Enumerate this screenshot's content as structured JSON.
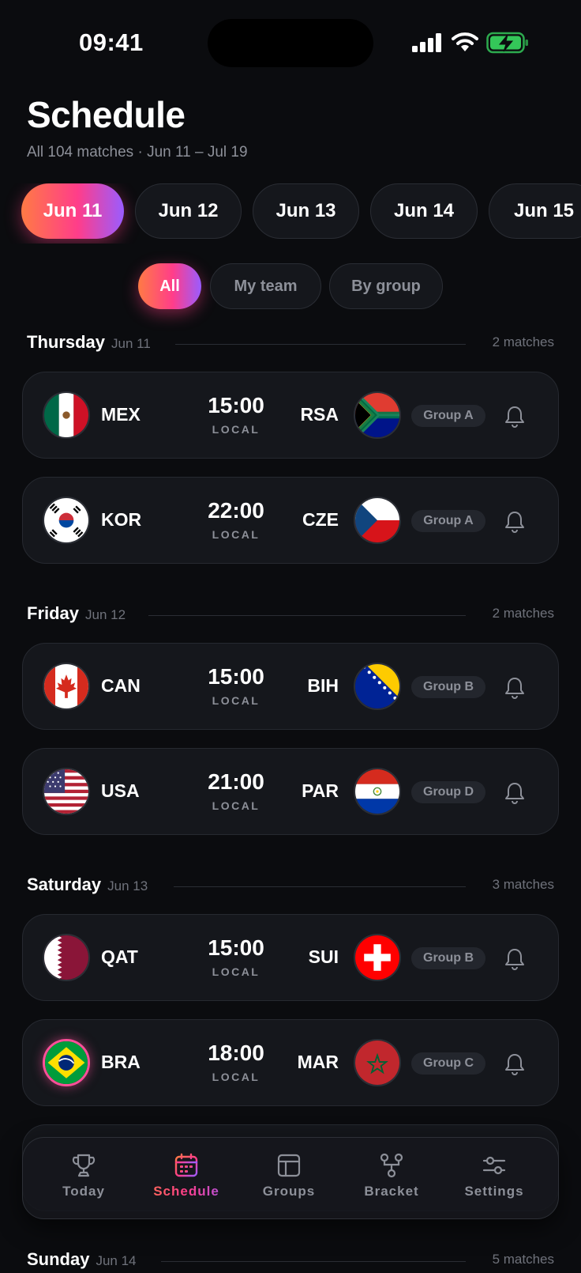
{
  "status_bar": {
    "time": "09:41"
  },
  "header": {
    "title": "Schedule",
    "subtitle": "All 104 matches · Jun 11 – Jul 19"
  },
  "date_chips": [
    "Jun 11",
    "Jun 12",
    "Jun 13",
    "Jun 14",
    "Jun 15"
  ],
  "selected_date": "Jun 11",
  "filters": [
    "All",
    "My team",
    "By group"
  ],
  "selected_filter": "All",
  "days": [
    {
      "name": "Thursday",
      "date": "Jun 11",
      "count": "2 matches",
      "matches": [
        {
          "home": "MEX",
          "away": "RSA",
          "time": "15:00",
          "zone": "LOCAL",
          "group": "Group A"
        },
        {
          "home": "KOR",
          "away": "CZE",
          "time": "22:00",
          "zone": "LOCAL",
          "group": "Group A"
        }
      ]
    },
    {
      "name": "Friday",
      "date": "Jun 12",
      "count": "2 matches",
      "matches": [
        {
          "home": "CAN",
          "away": "BIH",
          "time": "15:00",
          "zone": "LOCAL",
          "group": "Group B"
        },
        {
          "home": "USA",
          "away": "PAR",
          "time": "21:00",
          "zone": "LOCAL",
          "group": "Group D"
        }
      ]
    },
    {
      "name": "Saturday",
      "date": "Jun 13",
      "count": "3 matches",
      "matches": [
        {
          "home": "QAT",
          "away": "SUI",
          "time": "15:00",
          "zone": "LOCAL",
          "group": "Group B"
        },
        {
          "home": "BRA",
          "away": "MAR",
          "time": "18:00",
          "zone": "LOCAL",
          "group": "Group C",
          "favorite": true
        }
      ]
    },
    {
      "name": "Sunday",
      "date": "Jun 14",
      "count": "5 matches"
    }
  ],
  "tabs": [
    "Today",
    "Schedule",
    "Groups",
    "Bracket",
    "Settings"
  ],
  "active_tab": "Schedule",
  "colors": {
    "accent_start": "#ff7a45",
    "accent_mid": "#ff3d8a",
    "accent_end": "#9a5cff",
    "background": "#0b0c0f",
    "card": "#15171c"
  },
  "icons": {
    "tabs": [
      "trophy-icon",
      "calendar-icon",
      "table-icon",
      "bracket-icon",
      "sliders-icon"
    ],
    "match_action": "bell-icon"
  }
}
